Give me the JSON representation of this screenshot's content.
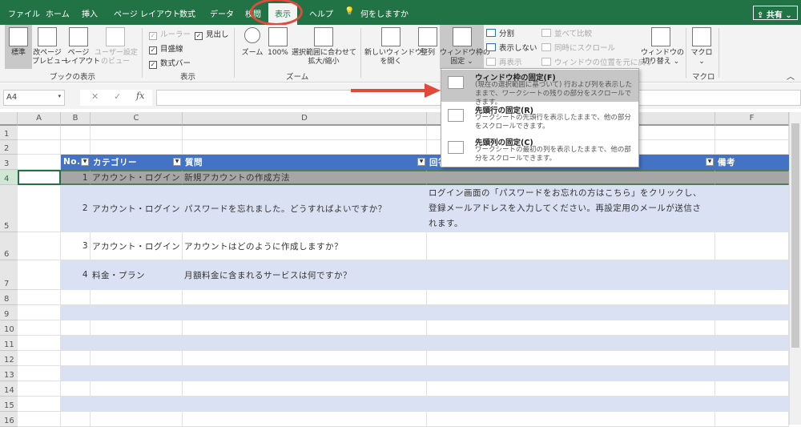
{
  "tabs": [
    "ファイル",
    "ホーム",
    "挿入",
    "ページ レイアウト",
    "数式",
    "データ",
    "校閲",
    "表示",
    "ヘルプ"
  ],
  "active_tab": "表示",
  "tell_me": "何をしますか",
  "share": "共有",
  "ribbon": {
    "book_view": {
      "label": "ブックの表示",
      "buttons": [
        "標準",
        "改ページ\nプレビュー",
        "ページ\nレイアウト",
        "ユーザー設定\nのビュー"
      ]
    },
    "show": {
      "label": "表示",
      "checks": [
        {
          "label": "ルーラー",
          "checked": true,
          "disabled": true
        },
        {
          "label": "目盛線",
          "checked": true
        },
        {
          "label": "数式バー",
          "checked": true
        },
        {
          "label": "見出し",
          "checked": true
        }
      ]
    },
    "zoom": {
      "label": "ズーム",
      "buttons": [
        "ズーム",
        "100%",
        "選択範囲に合わせて\n拡大/縮小"
      ]
    },
    "window": {
      "buttons": [
        "新しいウィンドウ\nを開く",
        "整列",
        "ウィンドウ枠の\n固定 ⌄"
      ],
      "small": [
        "分割",
        "表示しない",
        "再表示"
      ],
      "small2": [
        "並べて比較",
        "同時にスクロール",
        "ウィンドウの位置を元に戻す"
      ],
      "switch": "ウィンドウの\n切り替え ⌄"
    },
    "macro": {
      "label": "マクロ",
      "button": "マクロ\n⌄"
    }
  },
  "formula": {
    "name_box": "A4",
    "value": ""
  },
  "columns": [
    "A",
    "B",
    "C",
    "D",
    "E",
    "F"
  ],
  "rows": [
    "1",
    "2",
    "3",
    "4",
    "5",
    "6",
    "7",
    "8",
    "9",
    "10",
    "11",
    "12",
    "13",
    "14",
    "15",
    "16"
  ],
  "table": {
    "headers": [
      "No.",
      "カテゴリー",
      "質問",
      "回答",
      "備考"
    ],
    "data": [
      {
        "no": "1",
        "cat": "アカウント・ログイン",
        "q": "新規アカウントの作成方法",
        "a": ""
      },
      {
        "no": "2",
        "cat": "アカウント・ログイン",
        "q": "パスワードを忘れました。どうすればよいですか？",
        "a": [
          "ログイン画面の「パスワードをお忘れの方はこちら」をクリックし、",
          "登録メールアドレスを入力してください。再設定用のメールが送信さ",
          "れます。"
        ]
      },
      {
        "no": "3",
        "cat": "アカウント・ログイン",
        "q": "アカウントはどのように作成しますか？",
        "a": ""
      },
      {
        "no": "4",
        "cat": "料金・プラン",
        "q": "月額料金に含まれるサービスは何ですか？",
        "a": ""
      }
    ]
  },
  "freeze_menu": [
    {
      "title": "ウィンドウ枠の固定(F)",
      "desc": "(現在の選択範囲に基づいて) 行および列を表示したままで、ワークシートの残りの部分をスクロールできます。"
    },
    {
      "title": "先頭行の固定(R)",
      "desc": "ワークシートの先頭行を表示したままで、他の部分をスクロールできます。"
    },
    {
      "title": "先頭列の固定(C)",
      "desc": "ワークシートの最初の列を表示したままで、他の部分をスクロールできます。"
    }
  ],
  "colors": {
    "excel_green": "#217346",
    "table_header": "#4472c4",
    "band": "#d9e1f2",
    "annotation_red": "#e04a3a"
  }
}
